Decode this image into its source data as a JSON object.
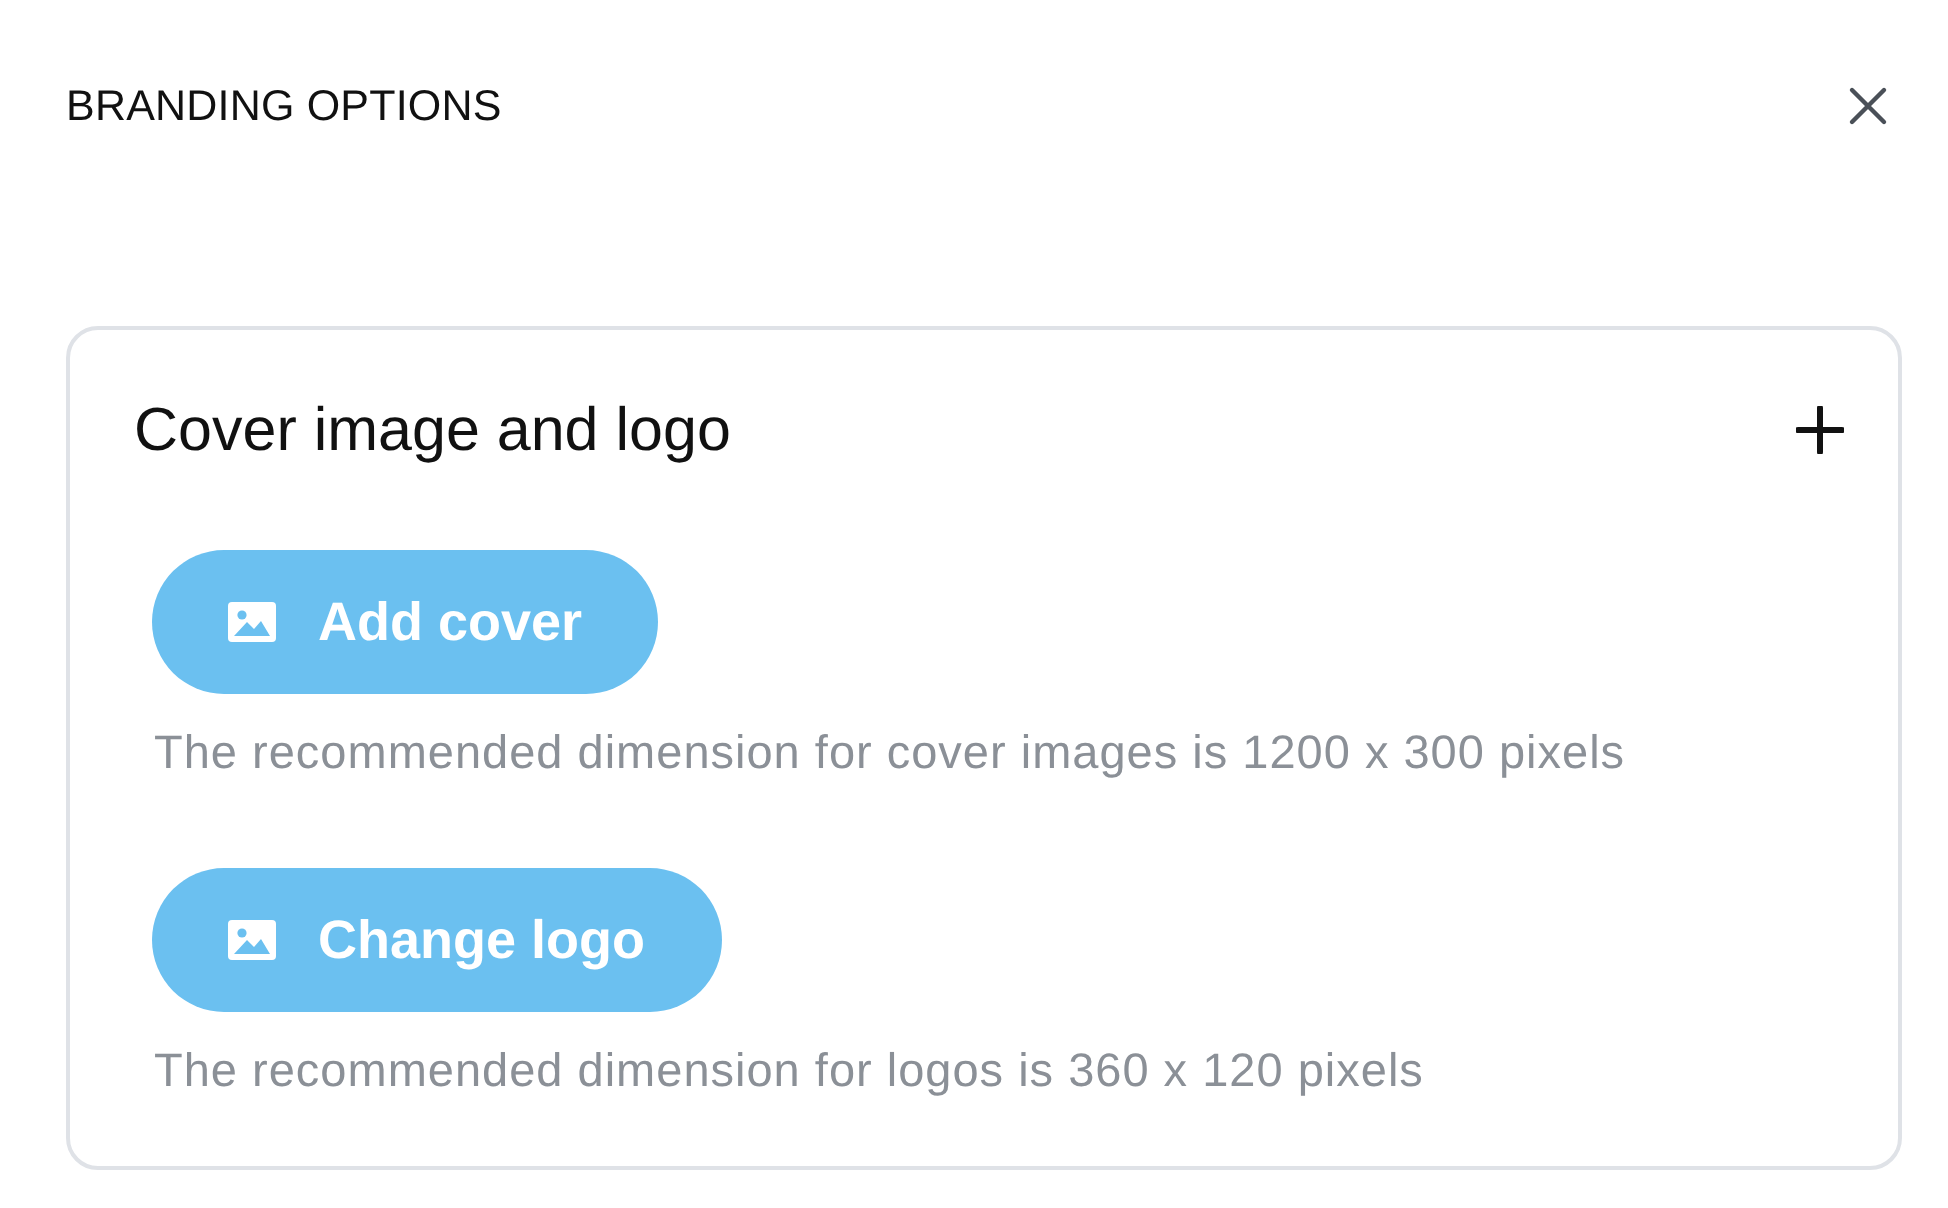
{
  "dialog": {
    "title": "BRANDING OPTIONS"
  },
  "section": {
    "title": "Cover image and logo",
    "uploads": [
      {
        "button": "Add cover",
        "hint": "The recommended dimension for cover images is 1200 x 300 pixels"
      },
      {
        "button": "Change logo",
        "hint": "The recommended dimension for logos is 360 x 120 pixels"
      }
    ]
  }
}
